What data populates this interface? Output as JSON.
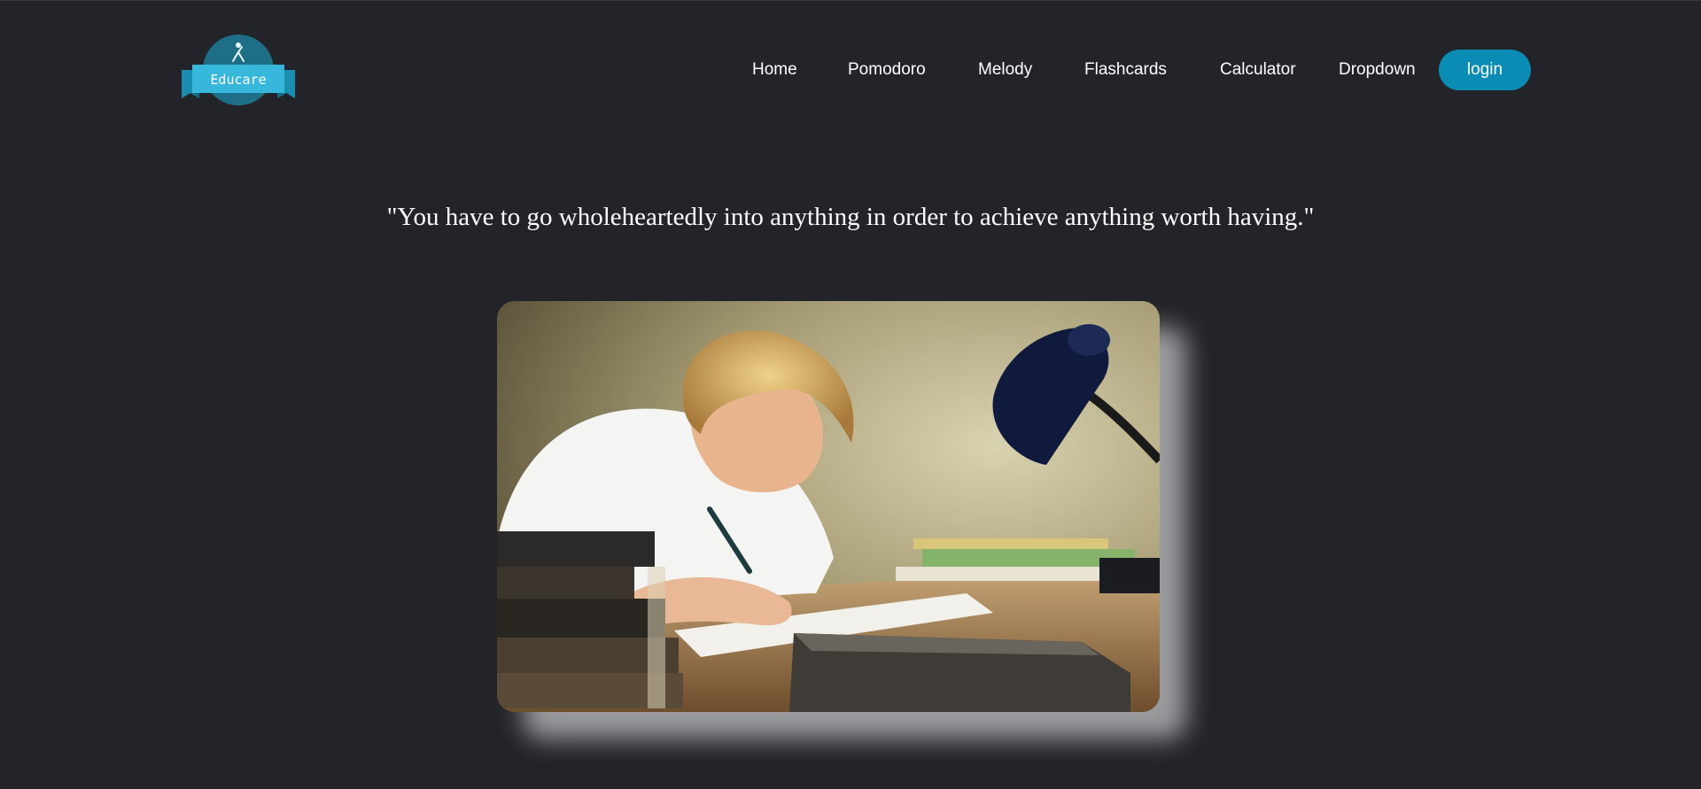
{
  "header": {
    "logo_text": "Educare",
    "nav": [
      {
        "label": "Home"
      },
      {
        "label": "Pomodoro"
      },
      {
        "label": "Melody"
      },
      {
        "label": "Flashcards"
      },
      {
        "label": "Calculator"
      },
      {
        "label": "Dropdown"
      }
    ],
    "login_label": "login"
  },
  "main": {
    "quote": "\"You have to go wholeheartedly into anything in order to achieve anything worth having.\"",
    "hero_image_icon": "student-studying-photo"
  },
  "colors": {
    "background": "#232429",
    "accent": "#0a8cb4",
    "text": "#ffffff",
    "logo_teal": "#2aa9cf"
  }
}
